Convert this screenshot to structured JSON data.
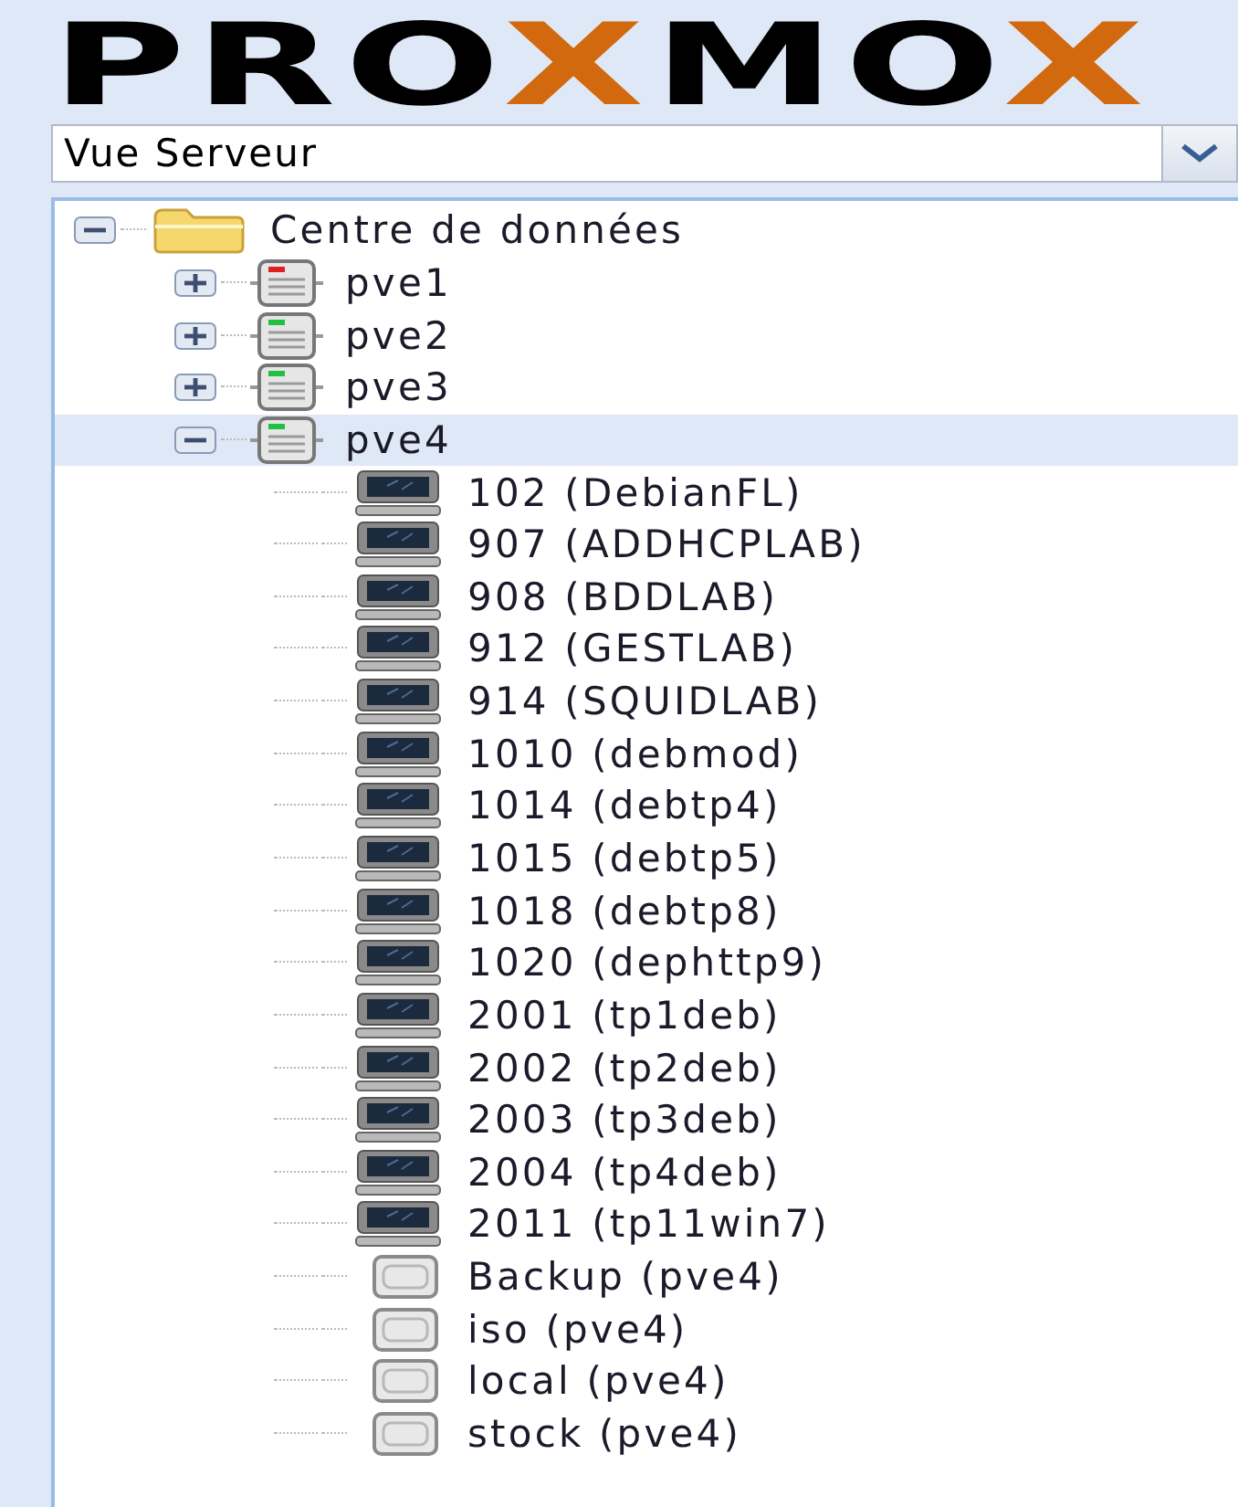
{
  "logo": [
    {
      "text": "PRO",
      "accent": false
    },
    {
      "text": "X",
      "accent": true
    },
    {
      "text": "MO",
      "accent": false
    },
    {
      "text": "X",
      "accent": true
    }
  ],
  "view_selector": {
    "value": "Vue Serveur"
  },
  "tree": [
    {
      "label": "Centre de données",
      "kind": "datacenter",
      "expanded": true,
      "selected": false,
      "children": [
        {
          "label": "pve1",
          "kind": "node",
          "color": "#e02020",
          "expanded": false,
          "selected": false
        },
        {
          "label": "pve2",
          "kind": "node",
          "color": "#20c040",
          "expanded": false,
          "selected": false
        },
        {
          "label": "pve3",
          "kind": "node",
          "color": "#20c040",
          "expanded": false,
          "selected": false
        },
        {
          "label": "pve4",
          "kind": "node",
          "color": "#20c040",
          "expanded": true,
          "selected": true,
          "children": [
            {
              "label": "102 (DebianFL)",
              "kind": "vm",
              "selected": false
            },
            {
              "label": "907 (ADDHCPLAB)",
              "kind": "vm",
              "selected": false
            },
            {
              "label": "908 (BDDLAB)",
              "kind": "vm",
              "selected": false
            },
            {
              "label": "912 (GESTLAB)",
              "kind": "vm",
              "selected": false
            },
            {
              "label": "914 (SQUIDLAB)",
              "kind": "vm",
              "selected": false
            },
            {
              "label": "1010 (debmod)",
              "kind": "vm",
              "selected": false
            },
            {
              "label": "1014 (debtp4)",
              "kind": "vm",
              "selected": false
            },
            {
              "label": "1015 (debtp5)",
              "kind": "vm",
              "selected": false
            },
            {
              "label": "1018 (debtp8)",
              "kind": "vm",
              "selected": false
            },
            {
              "label": "1020 (dephttp9)",
              "kind": "vm",
              "selected": false
            },
            {
              "label": "2001 (tp1deb)",
              "kind": "vm",
              "selected": false
            },
            {
              "label": "2002 (tp2deb)",
              "kind": "vm",
              "selected": false
            },
            {
              "label": "2003 (tp3deb)",
              "kind": "vm",
              "selected": false
            },
            {
              "label": "2004 (tp4deb)",
              "kind": "vm",
              "selected": false
            },
            {
              "label": "2011 (tp11win7)",
              "kind": "vm",
              "selected": false
            },
            {
              "label": "Backup (pve4)",
              "kind": "storage",
              "selected": false
            },
            {
              "label": "iso (pve4)",
              "kind": "storage",
              "selected": false
            },
            {
              "label": "local (pve4)",
              "kind": "storage",
              "selected": false
            },
            {
              "label": "stock (pve4)",
              "kind": "storage",
              "selected": false
            }
          ]
        }
      ]
    }
  ]
}
